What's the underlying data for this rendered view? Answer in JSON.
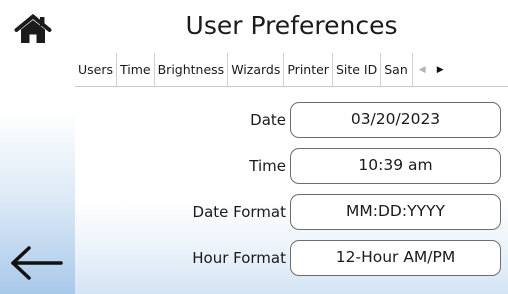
{
  "header": {
    "title": "User Preferences"
  },
  "tabs": [
    {
      "label": "Users"
    },
    {
      "label": "Time"
    },
    {
      "label": "Brightness"
    },
    {
      "label": "Wizards"
    },
    {
      "label": "Printer"
    },
    {
      "label": "Site ID"
    },
    {
      "label": "San"
    }
  ],
  "tabs_active": "Time",
  "fields": [
    {
      "label": "Date",
      "value": "03/20/2023"
    },
    {
      "label": "Time",
      "value": "10:39 am"
    },
    {
      "label": "Date Format",
      "value": "MM:DD:YYYY"
    },
    {
      "label": "Hour Format",
      "value": "12-Hour AM/PM"
    }
  ],
  "icons": {
    "home": "home-icon",
    "back": "arrow-left-icon",
    "scroll_left": "triangle-left-icon",
    "scroll_right": "triangle-right-icon"
  },
  "colors": {
    "sidebar_gradient_bottom": "#a9c9ea",
    "field_border": "#6d6d6d"
  }
}
